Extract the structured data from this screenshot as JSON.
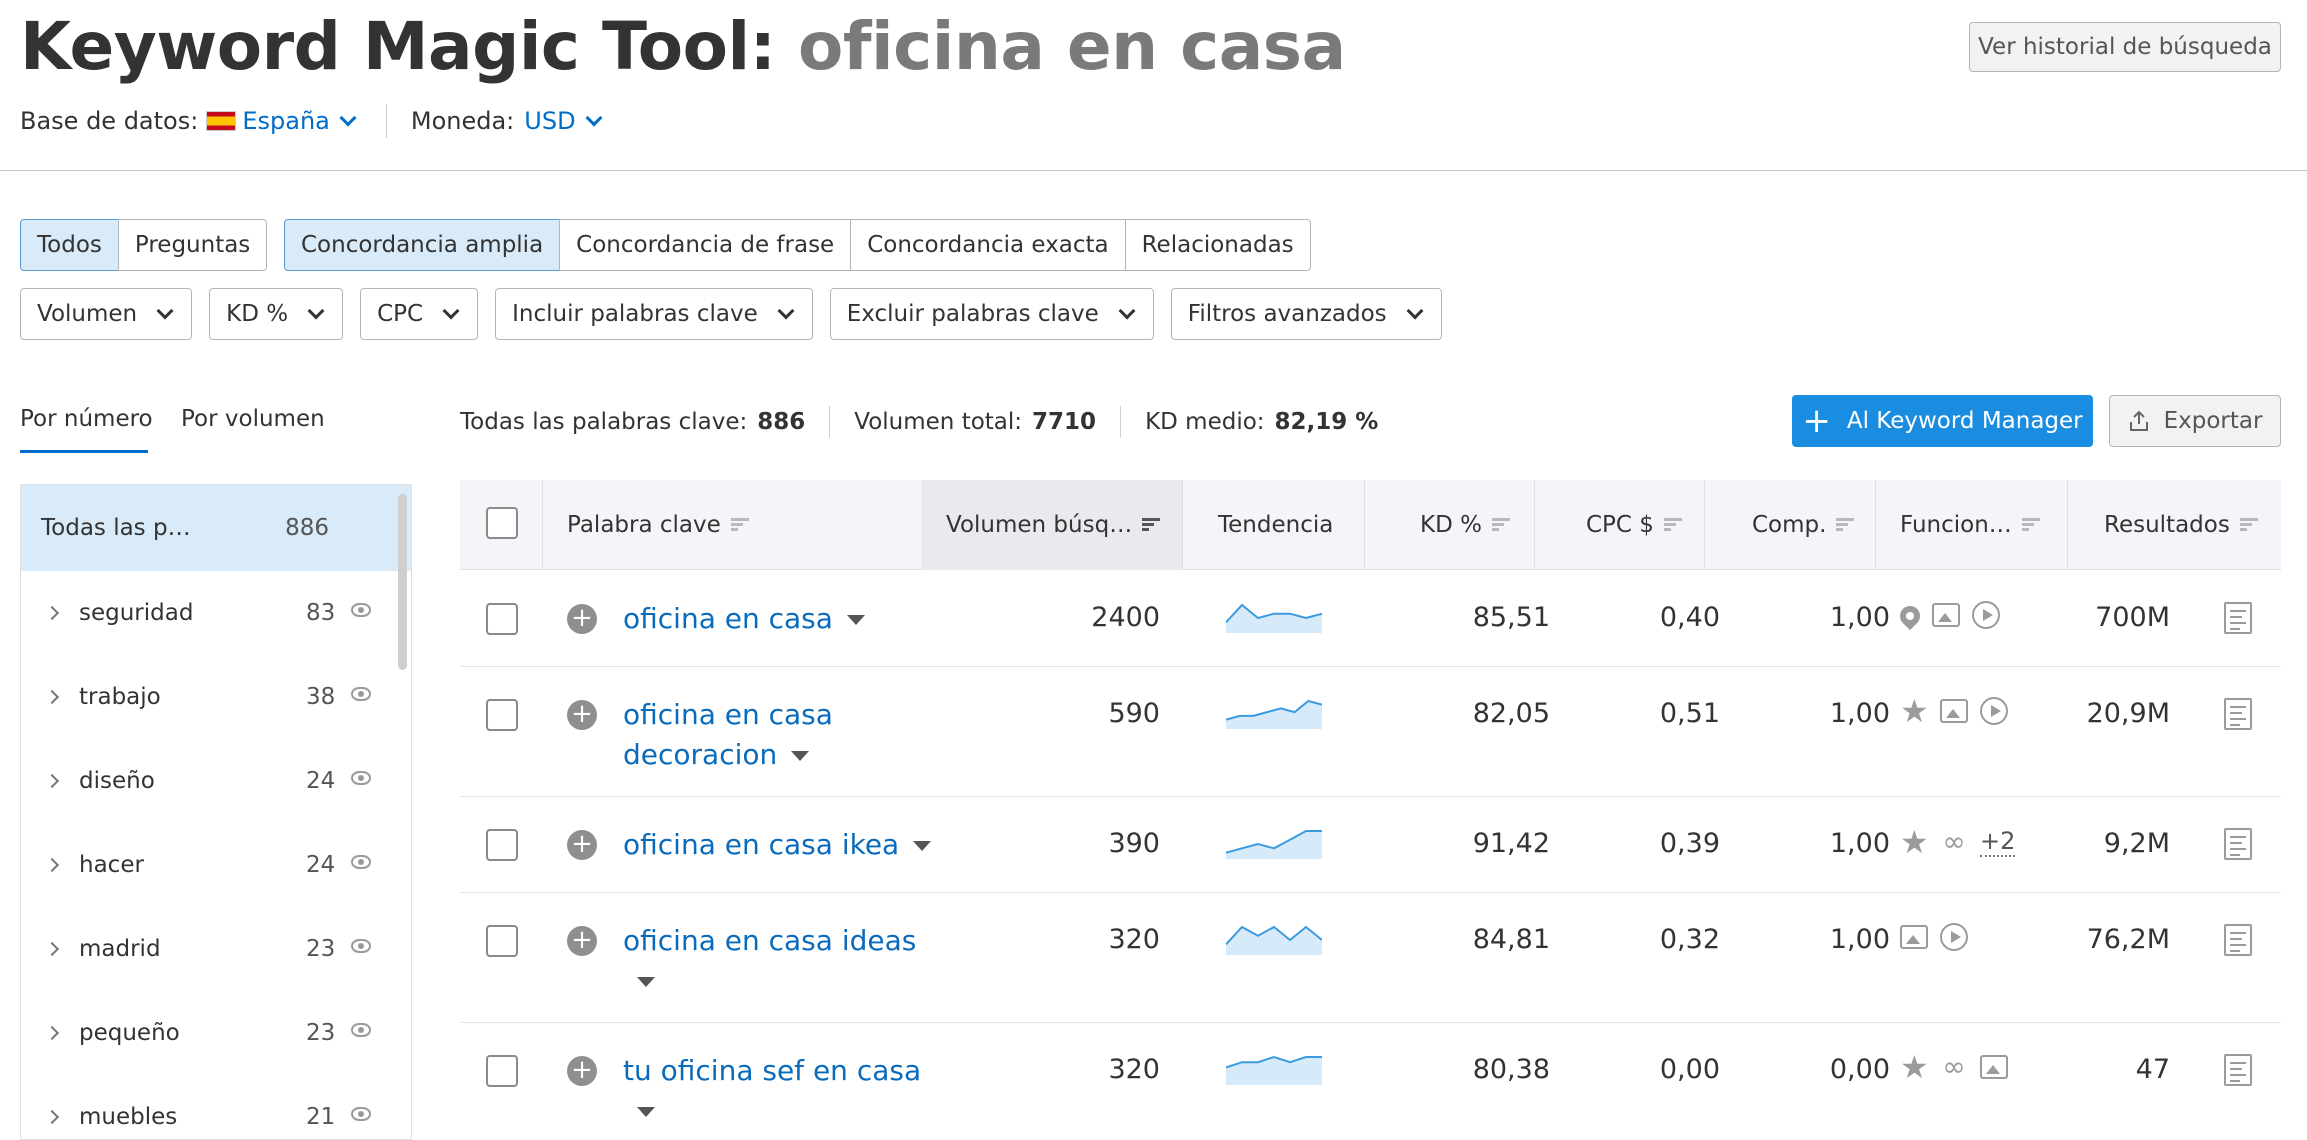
{
  "header": {
    "title_prefix": "Keyword Magic Tool:",
    "title_keyword": "oficina en casa",
    "history_button": "Ver historial de búsqueda",
    "database_label": "Base de datos:",
    "database_value": "España",
    "currency_label": "Moneda:",
    "currency_value": "USD"
  },
  "match_tabs": {
    "group1": [
      "Todos",
      "Preguntas"
    ],
    "group2": [
      "Concordancia amplia",
      "Concordancia de frase",
      "Concordancia exacta",
      "Relacionadas"
    ],
    "selected1": "Todos",
    "selected2": "Concordancia amplia"
  },
  "filters": [
    "Volumen",
    "KD %",
    "CPC",
    "Incluir palabras clave",
    "Excluir palabras clave",
    "Filtros avanzados"
  ],
  "sidebar": {
    "tab_number": "Por número",
    "tab_volume": "Por volumen",
    "all_label": "Todas las p…",
    "all_count": "886",
    "items": [
      {
        "label": "seguridad",
        "count": "83"
      },
      {
        "label": "trabajo",
        "count": "38"
      },
      {
        "label": "diseño",
        "count": "24"
      },
      {
        "label": "hacer",
        "count": "24"
      },
      {
        "label": "madrid",
        "count": "23"
      },
      {
        "label": "pequeño",
        "count": "23"
      },
      {
        "label": "muebles",
        "count": "21"
      }
    ]
  },
  "stats": {
    "all_label": "Todas las palabras clave:",
    "all_value": "886",
    "volume_label": "Volumen total:",
    "volume_value": "7710",
    "kd_label": "KD medio:",
    "kd_value": "82,19 %"
  },
  "actions": {
    "keyword_manager": "Al Keyword Manager",
    "export": "Exportar"
  },
  "table": {
    "columns": [
      "Palabra clave",
      "Volumen búsq…",
      "Tendencia",
      "KD %",
      "CPC $",
      "Comp.",
      "Funcion…",
      "Resultados"
    ],
    "rows": [
      {
        "keyword": "oficina en casa",
        "volume": "2400",
        "kd": "85,51",
        "cpc": "0,40",
        "comp": "1,00",
        "results": "700M",
        "features": [
          "pin-icon",
          "image-icon",
          "video-icon"
        ],
        "more": "",
        "trend": [
          2,
          6,
          3,
          4,
          4,
          3,
          4
        ]
      },
      {
        "keyword": "oficina en casa decoracion",
        "volume": "590",
        "kd": "82,05",
        "cpc": "0,51",
        "comp": "1,00",
        "results": "20,9M",
        "features": [
          "star-icon",
          "image-icon",
          "video-icon"
        ],
        "more": "",
        "trend": [
          2,
          3,
          3,
          4,
          5,
          4,
          7,
          6
        ]
      },
      {
        "keyword": "oficina en casa ikea",
        "volume": "390",
        "kd": "91,42",
        "cpc": "0,39",
        "comp": "1,00",
        "results": "9,2M",
        "features": [
          "star-icon",
          "link-icon"
        ],
        "more": "+2",
        "trend": [
          1,
          2,
          3,
          2,
          4,
          6,
          6
        ]
      },
      {
        "keyword": "oficina en casa ideas",
        "volume": "320",
        "kd": "84,81",
        "cpc": "0,32",
        "comp": "1,00",
        "results": "76,2M",
        "features": [
          "image-icon",
          "video-icon"
        ],
        "more": "",
        "trend": [
          2,
          6,
          4,
          6,
          3,
          6,
          3
        ]
      },
      {
        "keyword": "tu oficina sef en casa",
        "volume": "320",
        "kd": "80,38",
        "cpc": "0,00",
        "comp": "0,00",
        "results": "47",
        "features": [
          "star-icon",
          "link-icon",
          "image-icon"
        ],
        "more": "",
        "trend": [
          3,
          4,
          4,
          5,
          4,
          5,
          5
        ]
      }
    ]
  },
  "colors": {
    "accent": "#006dca",
    "primary_button": "#1a8de0",
    "selected_bg": "#d9eaf8",
    "trend": "#3a9be0"
  }
}
